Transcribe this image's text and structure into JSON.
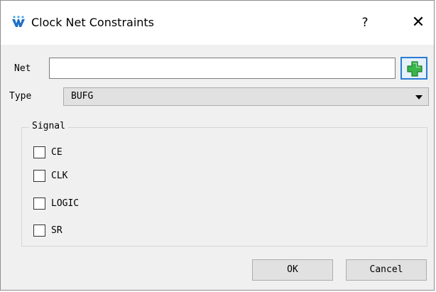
{
  "window": {
    "title": "Clock Net Constraints",
    "help_label": "?",
    "close_label": "✕"
  },
  "net": {
    "label": "Net",
    "value": ""
  },
  "type": {
    "label": "Type",
    "selected": "BUFG"
  },
  "signal": {
    "title": "Signal",
    "options": [
      {
        "label": "CE",
        "checked": false
      },
      {
        "label": "CLK",
        "checked": false
      },
      {
        "label": "LOGIC",
        "checked": false
      },
      {
        "label": "SR",
        "checked": false
      }
    ]
  },
  "buttons": {
    "ok": "OK",
    "cancel": "Cancel"
  },
  "colors": {
    "accent": "#2b7bd3",
    "plus_green": "#2fa32f"
  }
}
